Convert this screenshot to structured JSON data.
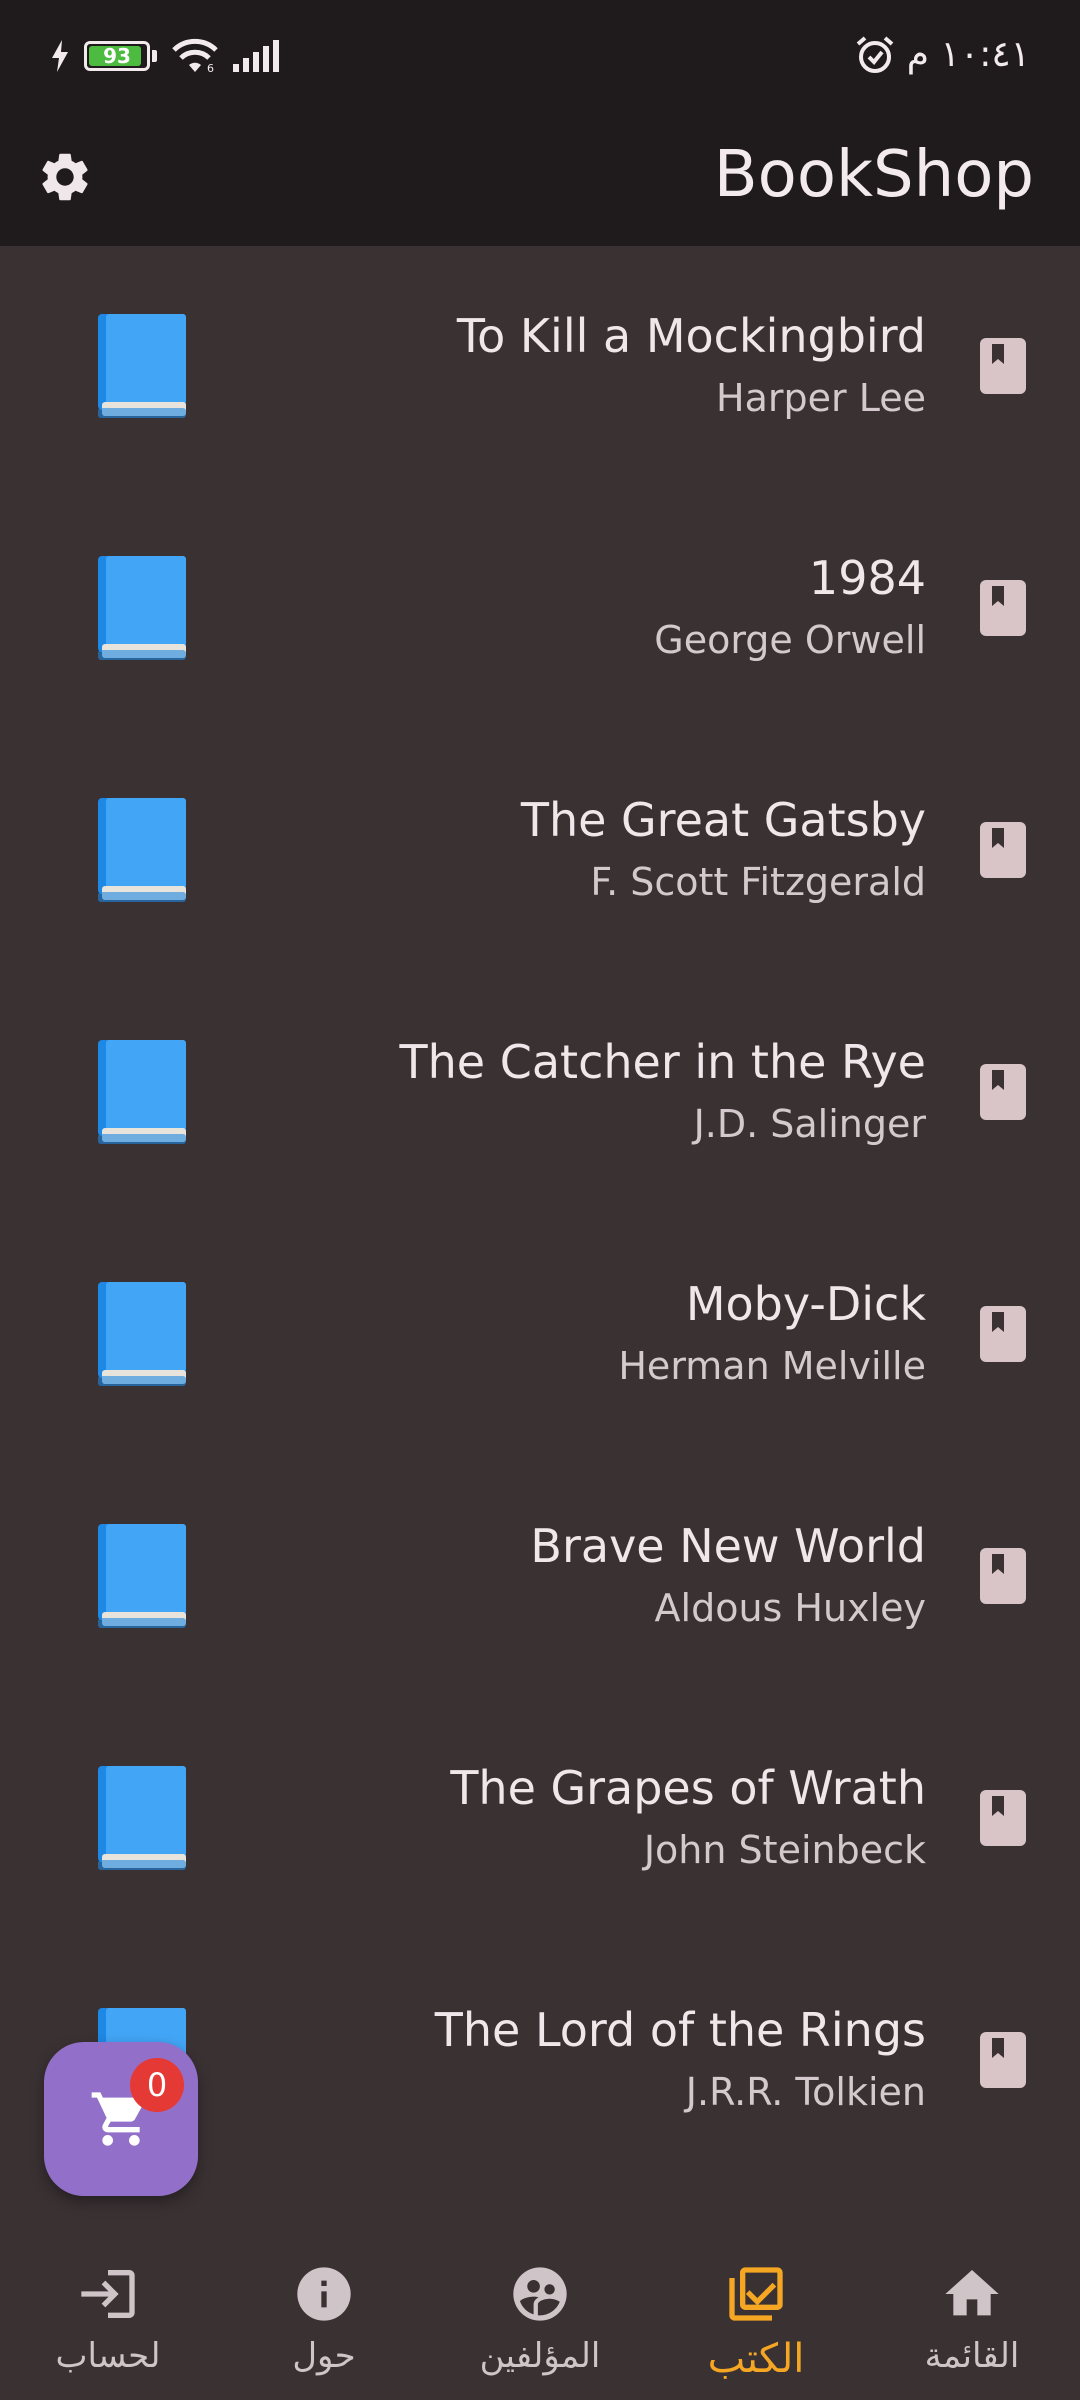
{
  "status_bar": {
    "time": "١٠:٤١ م",
    "battery_level": "93",
    "icons": [
      "charging-icon",
      "battery-icon",
      "wifi-icon",
      "signal-icon",
      "alarm-icon"
    ]
  },
  "app_bar": {
    "title": "BookShop",
    "settings_icon": "gear-icon"
  },
  "books": [
    {
      "title": "To Kill a Mockingbird",
      "author": "Harper Lee"
    },
    {
      "title": "1984",
      "author": "George Orwell"
    },
    {
      "title": "The Great Gatsby",
      "author": "F. Scott Fitzgerald"
    },
    {
      "title": "The Catcher in the Rye",
      "author": "J.D. Salinger"
    },
    {
      "title": "Moby-Dick",
      "author": "Herman Melville"
    },
    {
      "title": "Brave New World",
      "author": "Aldous Huxley"
    },
    {
      "title": "The Grapes of Wrath",
      "author": "John Steinbeck"
    },
    {
      "title": "The Lord of the Rings",
      "author": "J.R.R. Tolkien"
    }
  ],
  "cart": {
    "count": "0",
    "icon": "shopping-cart-icon"
  },
  "bottom_nav": {
    "items": [
      {
        "label": "القائمة",
        "icon": "home-icon",
        "active": false
      },
      {
        "label": "الكتب",
        "icon": "checked-library-icon",
        "active": true
      },
      {
        "label": "المؤلفين",
        "icon": "authors-icon",
        "active": false
      },
      {
        "label": "حول",
        "icon": "info-icon",
        "active": false
      },
      {
        "label": "لحساب",
        "icon": "login-icon",
        "active": false
      }
    ]
  },
  "colors": {
    "background": "#3a3133",
    "app_bar": "#1f1b1c",
    "accent_active": "#f5a623",
    "fab": "#9270c9",
    "badge": "#e53935",
    "book_blue": "#42a5f5"
  }
}
